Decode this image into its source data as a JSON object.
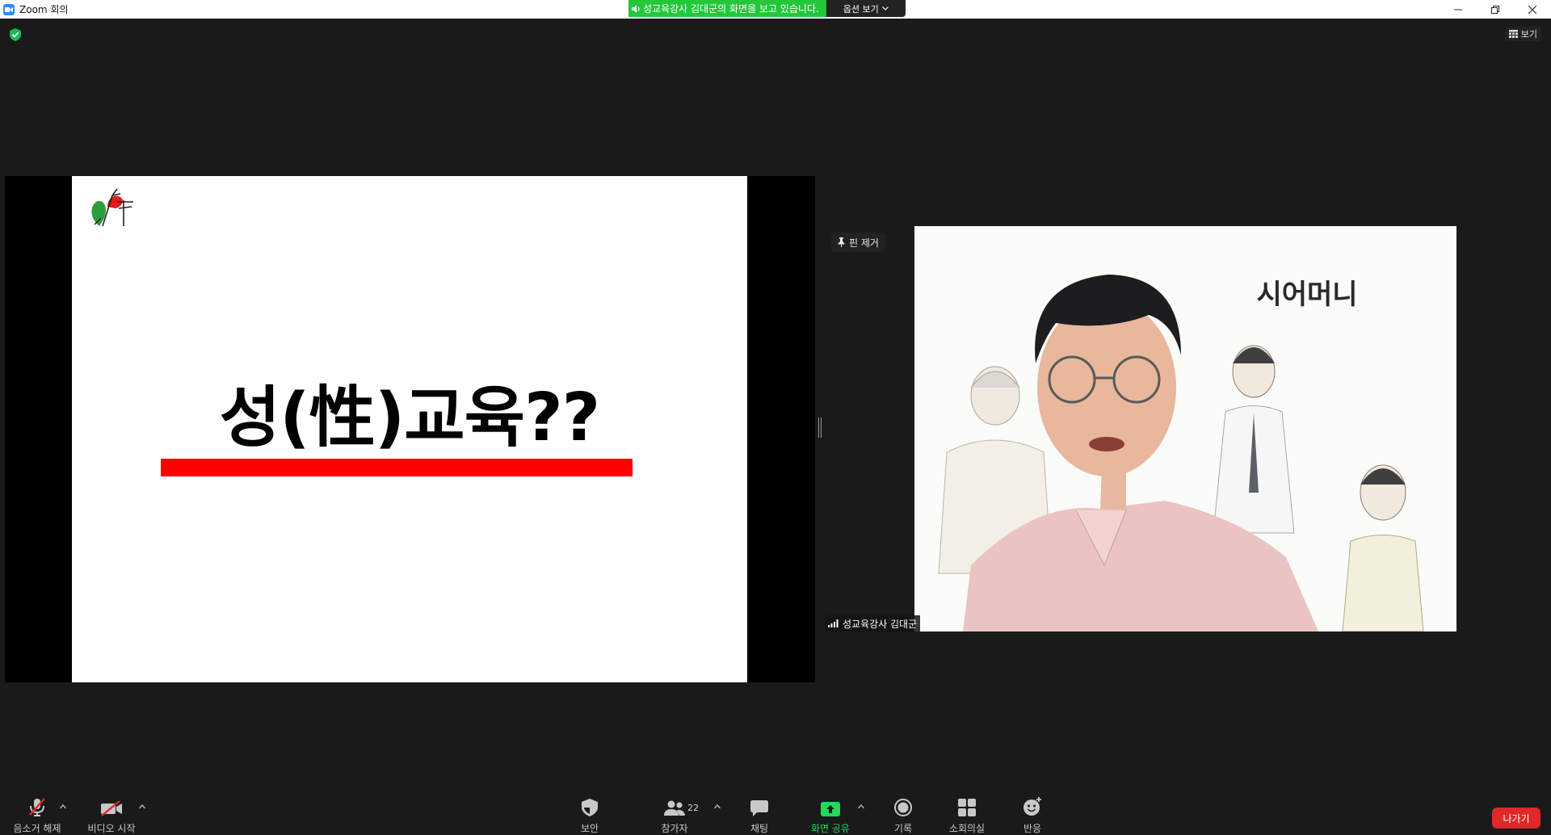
{
  "window": {
    "title": "Zoom 회의",
    "accent": "#2d8cff"
  },
  "banner": {
    "viewing_text": "성교육강사 김대군의 화면을 보고 있습니다.",
    "options_label": "옵션 보기",
    "color": "#24c73a"
  },
  "view_button": {
    "label": "보기"
  },
  "slide": {
    "title": "성(性)교육??",
    "bar_color": "#ff0000"
  },
  "participant": {
    "unpin_label": "핀 제거",
    "name": "성교육강사 김대군",
    "background_text": "시어머니"
  },
  "toolbar": {
    "unmute": "음소거 해제",
    "start_video": "비디오 시작",
    "security": "보안",
    "participants": "참가자",
    "participants_count": "22",
    "chat": "채팅",
    "share_screen": "화면 공유",
    "record": "기록",
    "breakout": "소회의실",
    "reactions": "반응",
    "leave": "나가기",
    "share_color": "#23d959",
    "leave_color": "#e02828"
  }
}
